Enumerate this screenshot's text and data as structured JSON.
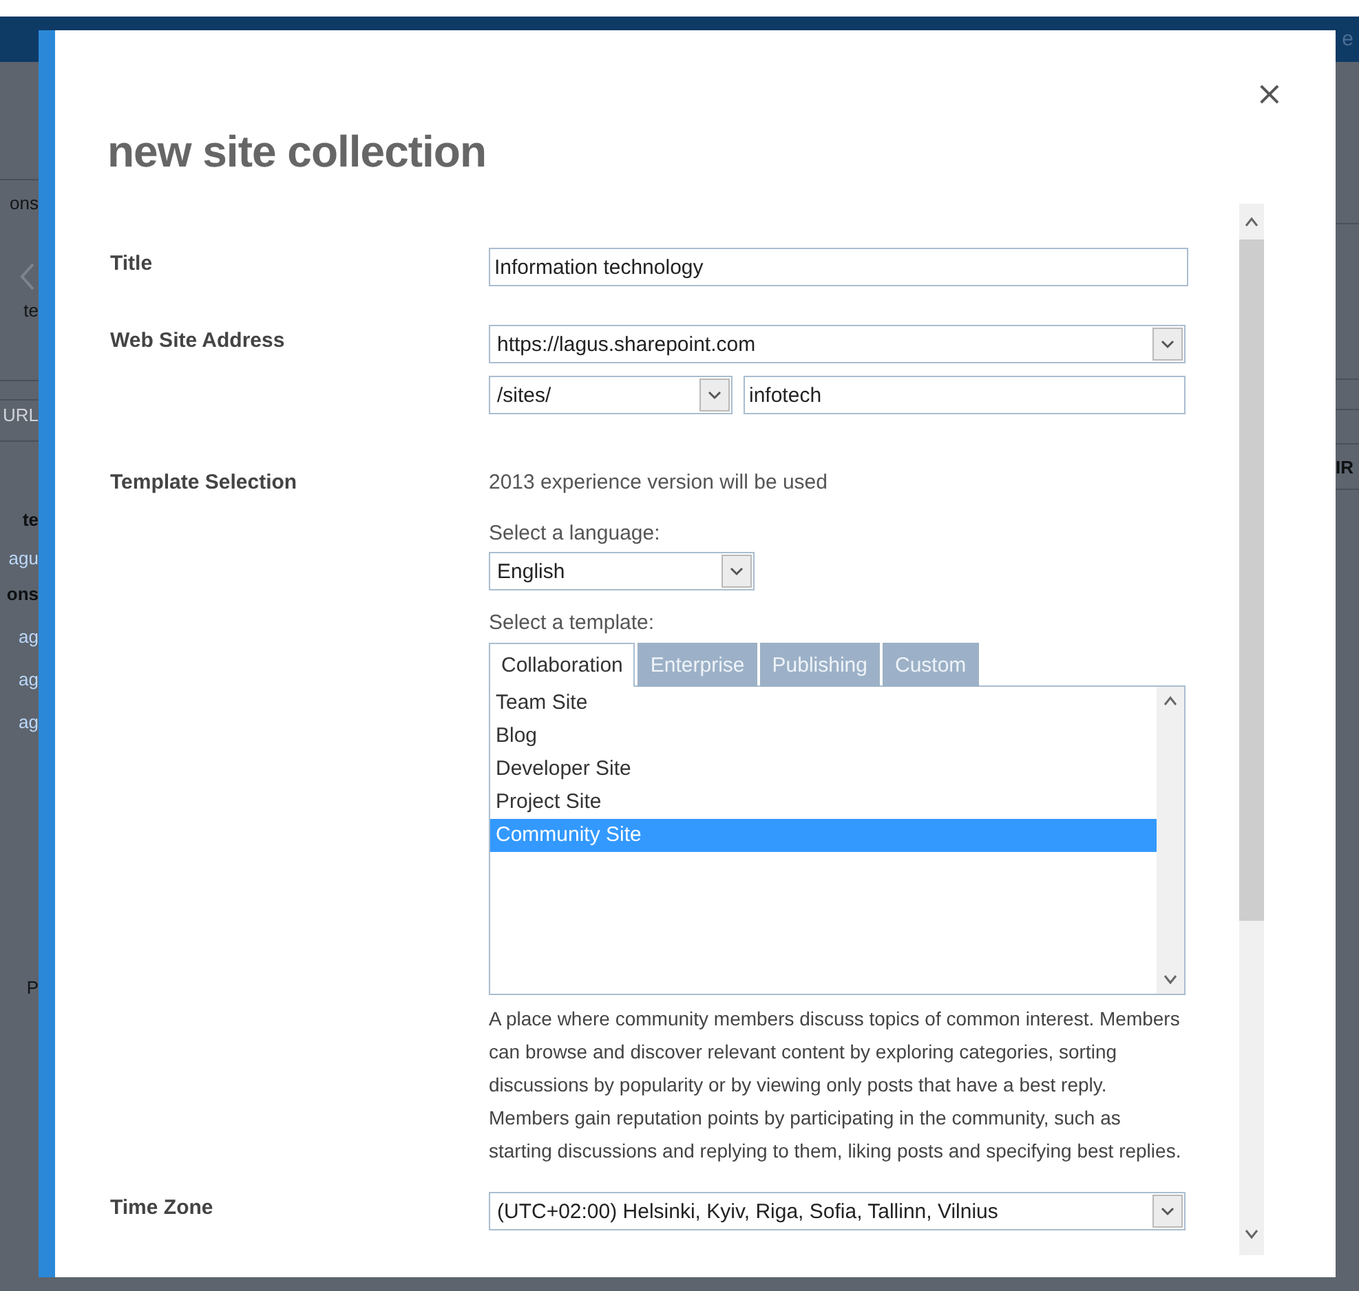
{
  "background": {
    "top_bar_text": "e",
    "left_fragments": [
      {
        "text": "ons",
        "kind": "label"
      },
      {
        "text": "te",
        "kind": "label"
      },
      {
        "text": "URL",
        "kind": "faint"
      },
      {
        "text": "te",
        "kind": "bold"
      },
      {
        "text": "agu",
        "kind": "link"
      },
      {
        "text": "ons",
        "kind": "bold"
      },
      {
        "text": "ag",
        "kind": "link"
      },
      {
        "text": "ag",
        "kind": "link"
      },
      {
        "text": "ag",
        "kind": "link"
      },
      {
        "text": "P",
        "kind": "label"
      }
    ],
    "right_fragments": [
      {
        "text": "IR",
        "kind": "bold"
      }
    ]
  },
  "dialog": {
    "title": "new site collection",
    "close": "×",
    "title_field": {
      "label": "Title",
      "value": "Information technology"
    },
    "web_site_address": {
      "label": "Web Site Address",
      "domain": "https://lagus.sharepoint.com",
      "path": "/sites/",
      "name": "infotech"
    },
    "template_selection": {
      "label": "Template Selection",
      "experience_note": "2013 experience version will be used",
      "language_label": "Select a language:",
      "language": "English",
      "template_label": "Select a template:",
      "tabs": [
        {
          "label": "Collaboration",
          "selected": true
        },
        {
          "label": "Enterprise",
          "selected": false
        },
        {
          "label": "Publishing",
          "selected": false
        },
        {
          "label": "Custom",
          "selected": false
        }
      ],
      "templates": [
        {
          "label": "Team Site",
          "selected": false
        },
        {
          "label": "Blog",
          "selected": false
        },
        {
          "label": "Developer Site",
          "selected": false
        },
        {
          "label": "Project Site",
          "selected": false
        },
        {
          "label": "Community Site",
          "selected": true
        }
      ],
      "description": "A place where community members discuss topics of common interest. Members can browse and discover relevant content by exploring categories, sorting discussions by popularity or by viewing only posts that have a best reply. Members gain reputation points by participating in the community, such as starting discussions and replying to them, liking posts and specifying best replies."
    },
    "time_zone": {
      "label": "Time Zone",
      "value": "(UTC+02:00) Helsinki, Kyiv, Riga, Sofia, Tallinn, Vilnius"
    }
  }
}
